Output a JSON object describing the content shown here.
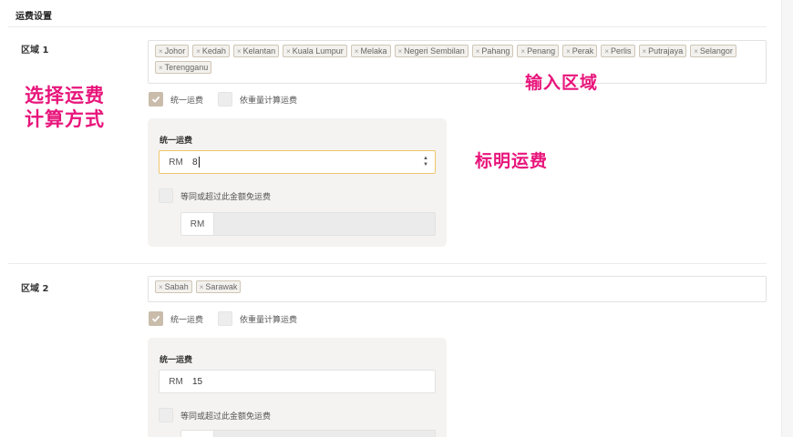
{
  "page": {
    "section_title": "运费设置"
  },
  "regions": [
    {
      "label": "区域 1",
      "states": [
        "Johor",
        "Kedah",
        "Kelantan",
        "Kuala Lumpur",
        "Melaka",
        "Negeri Sembilan",
        "Pahang",
        "Penang",
        "Perak",
        "Perlis",
        "Putrajaya",
        "Selangor",
        "Terengganu"
      ],
      "options": {
        "flat": "统一运费",
        "weight": "依重量计算运费",
        "flat_checked": true,
        "weight_checked": false
      },
      "card": {
        "title": "统一运费",
        "currency": "RM",
        "fee": "8",
        "free_label": "等同或超过此金额免运费",
        "free_currency": "RM",
        "free_value": ""
      }
    },
    {
      "label": "区域 2",
      "states": [
        "Sabah",
        "Sarawak"
      ],
      "options": {
        "flat": "统一运费",
        "weight": "依重量计算运费",
        "flat_checked": true,
        "weight_checked": false
      },
      "card": {
        "title": "统一运费",
        "currency": "RM",
        "fee": "15",
        "free_label": "等同或超过此金额免运费",
        "free_currency": "RM",
        "free_value": ""
      }
    }
  ],
  "annotations": {
    "choose_method": [
      "选择运费",
      "计算方式"
    ],
    "enter_region": "输入区域",
    "specify_fee": "标明运费"
  },
  "colors": {
    "annotation": "#e8157b",
    "checkbox_checked": "#c9bcab",
    "focus_border": "#f0c46b",
    "card_bg": "#f4f3f1"
  },
  "icons": {
    "tag_remove": "×",
    "checkbox": "checkmark-icon",
    "number_spinner": "up-down-arrows-icon"
  }
}
